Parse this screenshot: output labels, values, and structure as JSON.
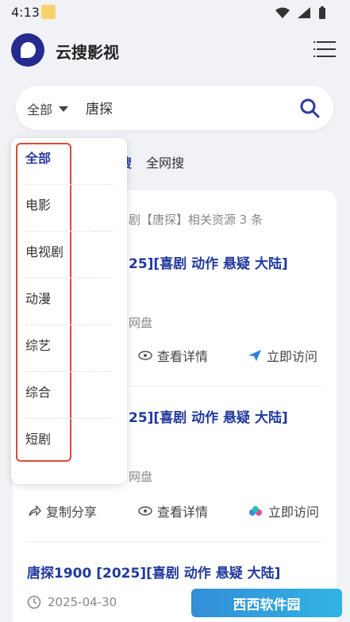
{
  "status_bar": {
    "time": "4:13"
  },
  "header": {
    "title": "云搜影视"
  },
  "search": {
    "scope": "全部",
    "query": "唐探"
  },
  "tabs": [
    {
      "label": "搜",
      "active": true
    },
    {
      "label": "全网搜",
      "active": false
    }
  ],
  "results": {
    "summary": "剧【唐探】相关资源 3 条",
    "items": [
      {
        "title": "25][喜剧 动作 悬疑 大陆]",
        "source": "网盘"
      },
      {
        "title": "25][喜剧 动作 悬疑 大陆]",
        "source": "网盘"
      },
      {
        "title": "唐探1900 [2025][喜剧 动作 悬疑 大陆]",
        "date": "2025-04-30"
      }
    ],
    "actions": {
      "copy": "复制分享",
      "details": "查看详情",
      "visit": "立即访问"
    }
  },
  "dropdown": {
    "items": [
      "全部",
      "电影",
      "电视剧",
      "动漫",
      "综艺",
      "综合",
      "短剧"
    ],
    "selected": "全部"
  },
  "watermark": {
    "text": "西西软件园"
  },
  "colors": {
    "accent": "#2c3a9f",
    "highlight_frame": "#d94a38"
  }
}
